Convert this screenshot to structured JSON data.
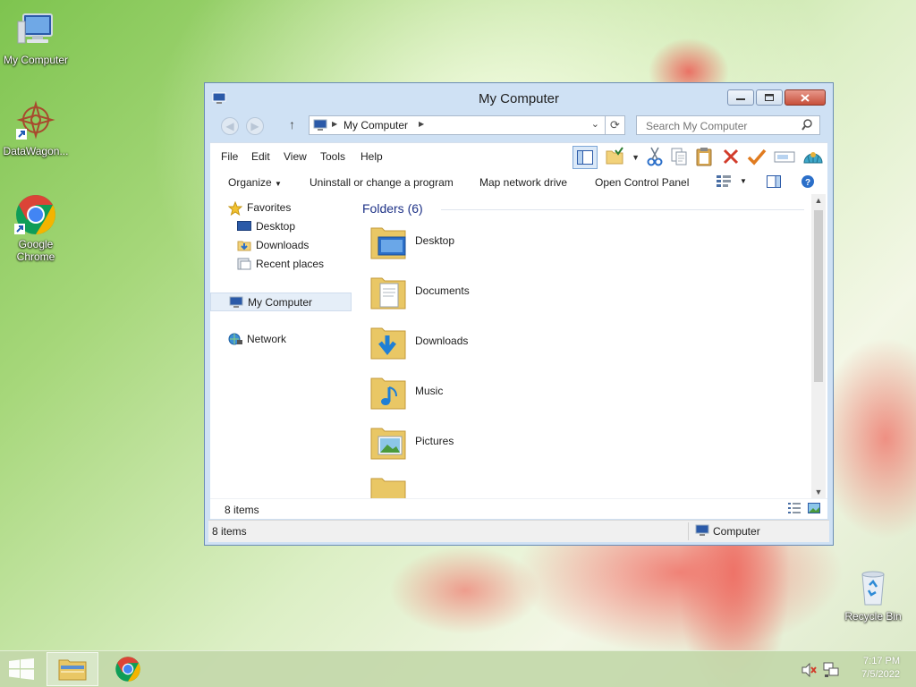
{
  "desktop": {
    "icons": [
      {
        "label": "My Computer"
      },
      {
        "label": "DataWagon..."
      },
      {
        "label": "Google Chrome"
      },
      {
        "label": "Recycle Bin"
      }
    ]
  },
  "window": {
    "title": "My Computer",
    "address": {
      "segment": "My Computer"
    },
    "search_placeholder": "Search My Computer",
    "menu": [
      "File",
      "Edit",
      "View",
      "Tools",
      "Help"
    ],
    "commands": {
      "organize": "Organize",
      "uninstall": "Uninstall or change a program",
      "map_drive": "Map network drive",
      "control_panel": "Open Control Panel"
    },
    "nav": {
      "favorites": "Favorites",
      "desktop": "Desktop",
      "downloads": "Downloads",
      "recent": "Recent places",
      "computer": "My Computer",
      "network": "Network"
    },
    "group_header": "Folders (6)",
    "folders": [
      {
        "name": "Desktop",
        "icon": "desktop-folder-icon"
      },
      {
        "name": "Documents",
        "icon": "documents-folder-icon"
      },
      {
        "name": "Downloads",
        "icon": "downloads-folder-icon"
      },
      {
        "name": "Music",
        "icon": "music-folder-icon"
      },
      {
        "name": "Pictures",
        "icon": "pictures-folder-icon"
      }
    ],
    "details_count": "8 items",
    "status": {
      "count": "8 items",
      "location": "Computer"
    }
  },
  "taskbar": {
    "time": "7:17 PM",
    "date": "7/5/2022"
  },
  "colors": {
    "accent": "#1e3287",
    "close_button": "#c7503b",
    "chrome_red": "#db4437",
    "chrome_green": "#0f9d58",
    "chrome_yellow": "#f4b400",
    "chrome_blue": "#4285f4"
  }
}
